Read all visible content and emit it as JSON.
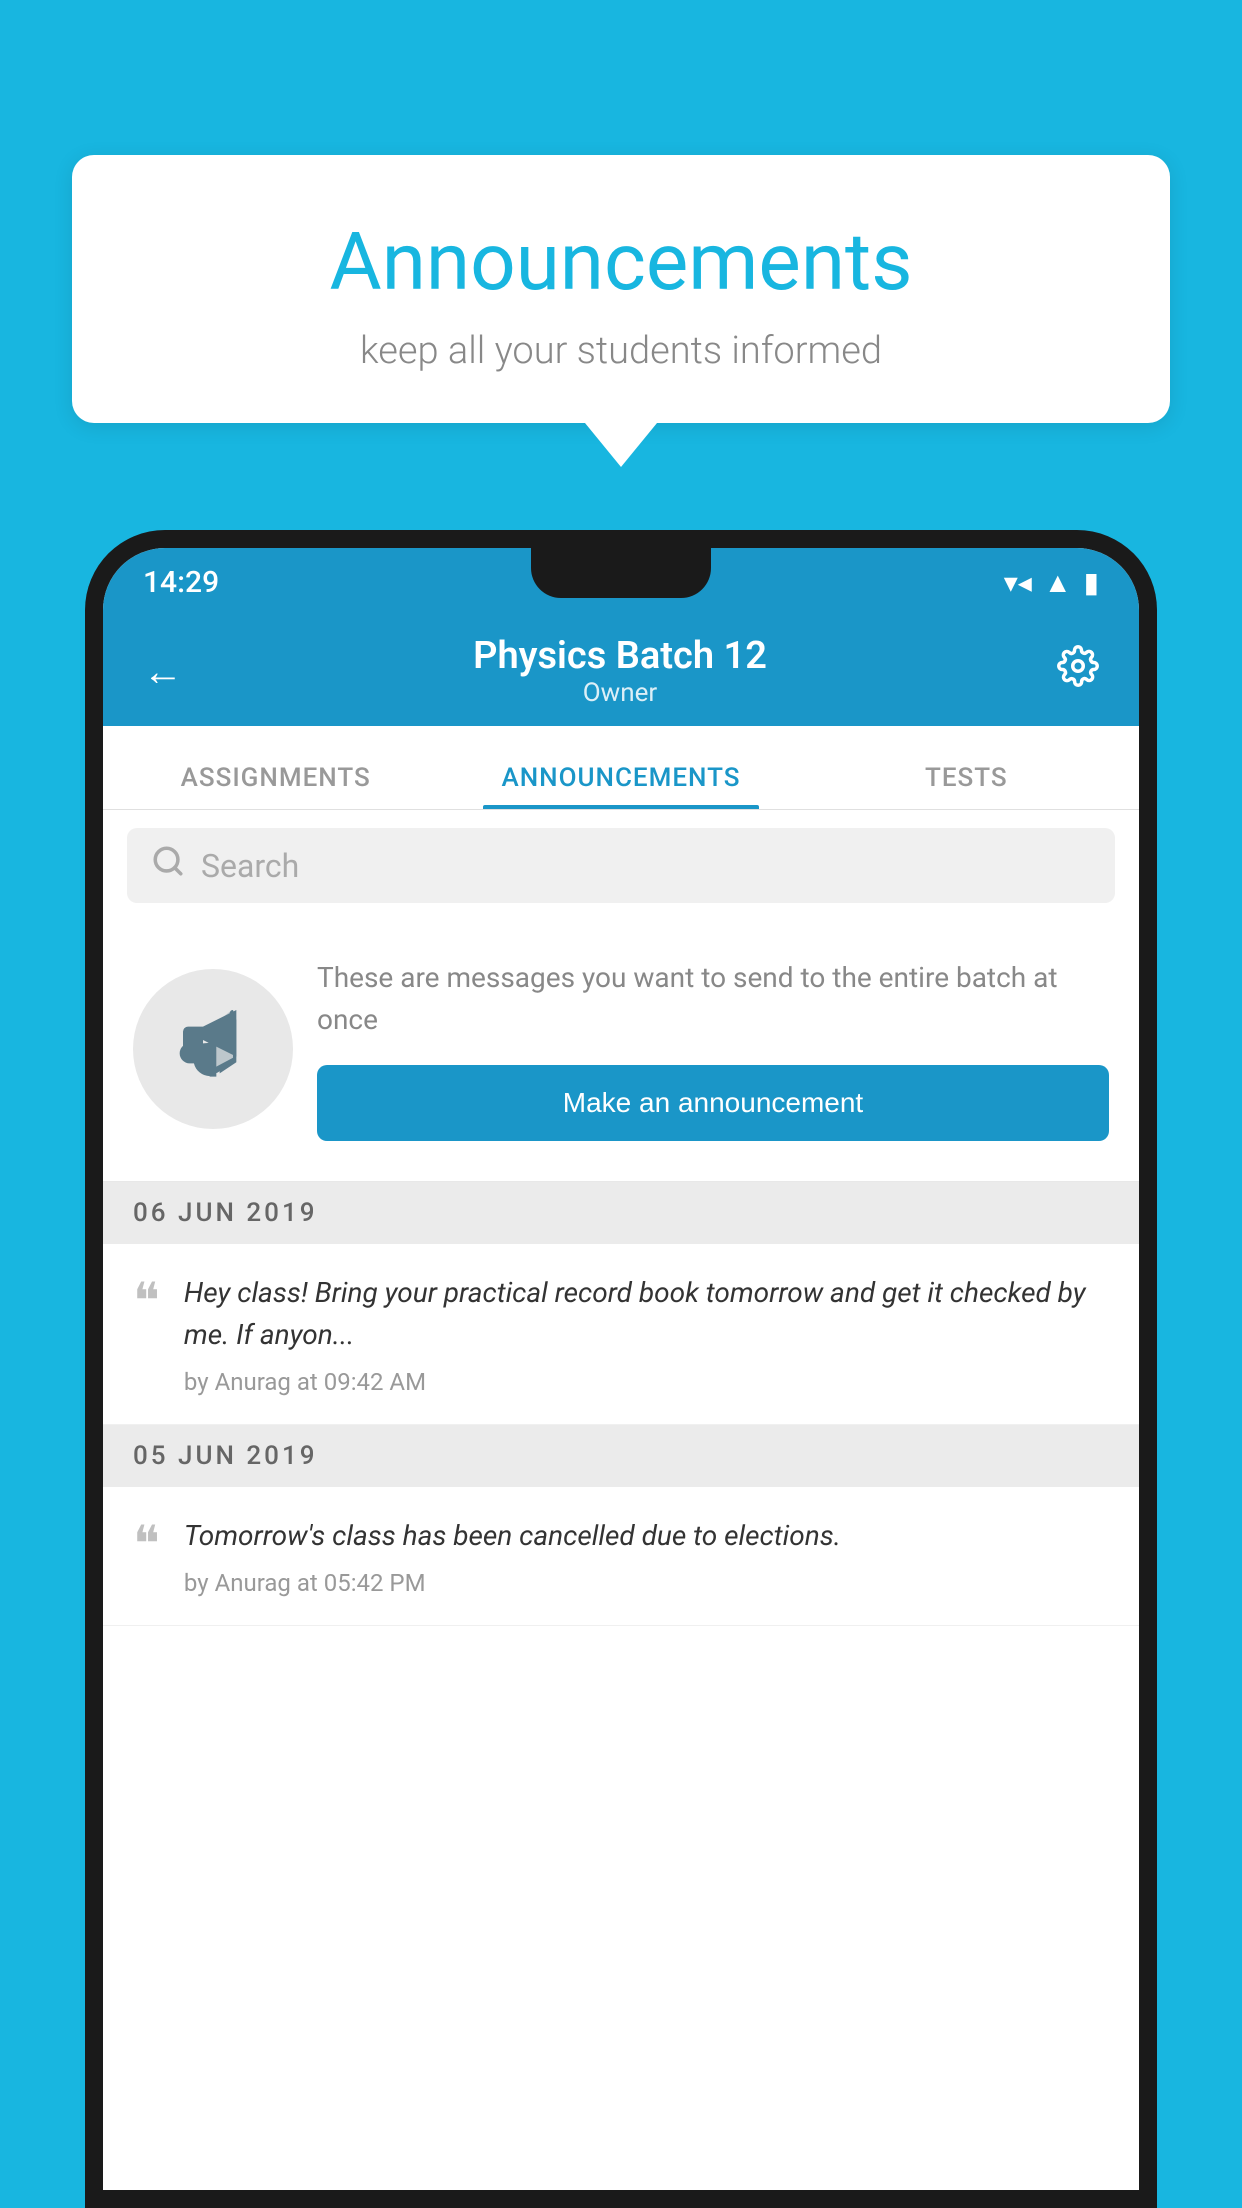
{
  "background_color": "#18b6e0",
  "speech_bubble": {
    "title": "Announcements",
    "subtitle": "keep all your students informed"
  },
  "phone": {
    "status_bar": {
      "time": "14:29",
      "wifi": "▼▲",
      "signal": "▲",
      "battery": "▮"
    },
    "app_bar": {
      "title": "Physics Batch 12",
      "subtitle": "Owner",
      "back_label": "←",
      "settings_label": "⚙"
    },
    "tabs": [
      {
        "label": "ASSIGNMENTS",
        "active": false
      },
      {
        "label": "ANNOUNCEMENTS",
        "active": true
      },
      {
        "label": "TESTS",
        "active": false
      }
    ],
    "search": {
      "placeholder": "Search"
    },
    "promo": {
      "description": "These are messages you want to send to the entire batch at once",
      "button_label": "Make an announcement"
    },
    "announcements": [
      {
        "date": "06  JUN  2019",
        "message": "Hey class! Bring your practical record book tomorrow and get it checked by me. If anyon...",
        "meta": "by Anurag at 09:42 AM"
      },
      {
        "date": "05  JUN  2019",
        "message": "Tomorrow's class has been cancelled due to elections.",
        "meta": "by Anurag at 05:42 PM"
      }
    ]
  }
}
